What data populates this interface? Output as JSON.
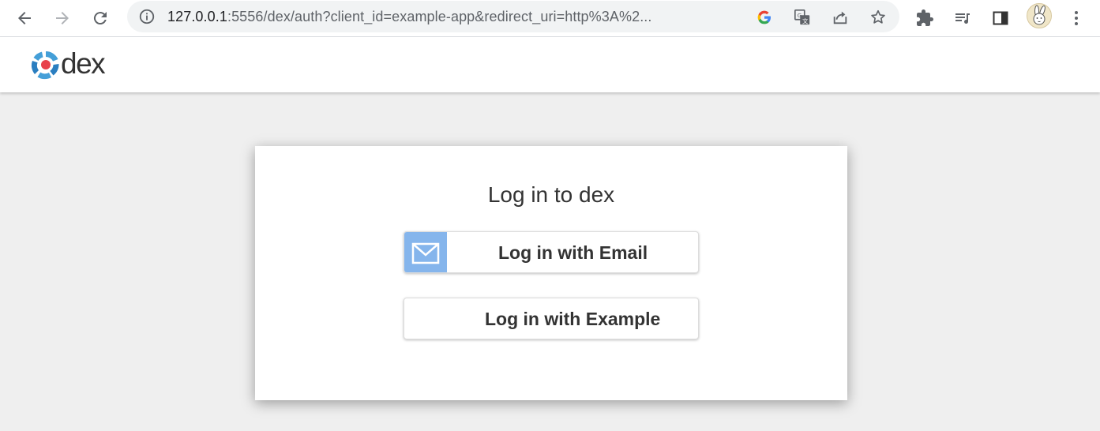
{
  "browser": {
    "url_host": "127.0.0.1",
    "url_rest": ":5556/dex/auth?client_id=example-app&redirect_uri=http%3A%2...",
    "icons": [
      "back-icon",
      "forward-icon",
      "reload-icon",
      "info-icon",
      "google-icon",
      "translate-icon",
      "share-icon",
      "bookmark-star-icon",
      "extensions-icon",
      "media-control-icon",
      "side-panel-icon",
      "profile-avatar",
      "menu-icon"
    ]
  },
  "header": {
    "brand": "dex"
  },
  "login": {
    "title": "Log in to dex",
    "email_button": "Log in with Email",
    "example_button": "Log in with Example"
  },
  "colors": {
    "email_icon_bg": "#85b5ec",
    "page_bg": "#efefef"
  }
}
